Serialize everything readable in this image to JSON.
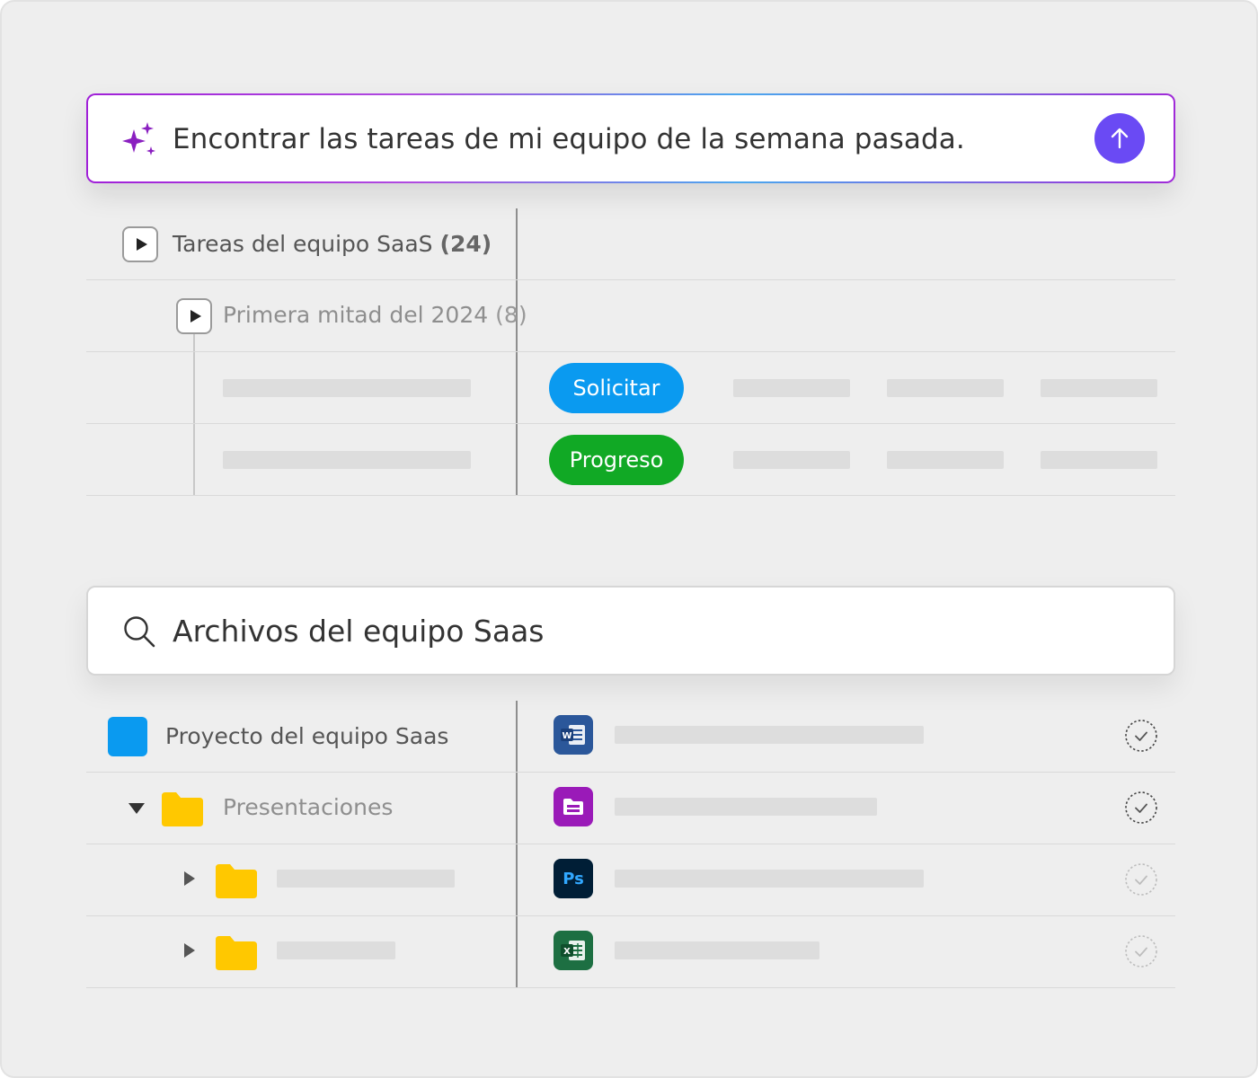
{
  "prompt": {
    "text": "Encontrar las tareas de mi equipo de la semana pasada.",
    "sparkle_icon": "sparkles-icon",
    "send_icon": "arrow-up-icon",
    "accent": "#6a4af4"
  },
  "tasks": {
    "group": {
      "label": "Tareas del equipo SaaS",
      "count": "(24)"
    },
    "subgroup": {
      "label": "Primera mitad del 2024",
      "count": "(8)"
    },
    "rows": [
      {
        "status": "Solicitar",
        "status_color": "#0a9af0"
      },
      {
        "status": "Progreso",
        "status_color": "#11a925"
      }
    ]
  },
  "search": {
    "text": "Archivos del equipo Saas",
    "icon": "search-icon"
  },
  "files": {
    "project": {
      "label": "Proyecto del equipo Saas",
      "color": "#0a9af0"
    },
    "folder": {
      "label": "Presentaciones",
      "color": "#ffc800"
    },
    "apps": [
      {
        "icon": "word-icon",
        "glyph": "W",
        "color": "#2b579a"
      },
      {
        "icon": "presentation-icon",
        "glyph": "",
        "color": "#9a1ab8"
      },
      {
        "icon": "photoshop-icon",
        "glyph": "Ps",
        "color": "#001e36"
      },
      {
        "icon": "excel-icon",
        "glyph": "X",
        "color": "#1d6f42"
      }
    ]
  }
}
